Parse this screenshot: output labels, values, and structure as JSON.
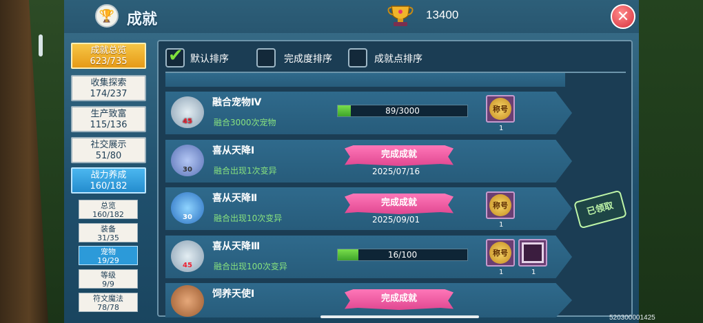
{
  "header": {
    "title": "成就",
    "score": "13400",
    "close_label": "✕"
  },
  "sidebar": {
    "items": [
      {
        "label": "成就总览",
        "count": "623/735"
      },
      {
        "label": "收集探索",
        "count": "174/237"
      },
      {
        "label": "生产致富",
        "count": "115/136"
      },
      {
        "label": "社交展示",
        "count": "51/80"
      },
      {
        "label": "战力养成",
        "count": "160/182"
      }
    ],
    "subitems": [
      {
        "label": "总览",
        "count": "160/182"
      },
      {
        "label": "装备",
        "count": "31/35"
      },
      {
        "label": "宠物",
        "count": "19/29"
      },
      {
        "label": "等级",
        "count": "9/9"
      },
      {
        "label": "符文魔法",
        "count": "78/78"
      }
    ]
  },
  "sort": {
    "default": "默认排序",
    "completion": "完成度排序",
    "points": "成就点排序"
  },
  "achievements": [
    {
      "name": "融合宠物Ⅳ",
      "desc": "融合3000次宠物",
      "level": "45",
      "progress_text": "89/3000",
      "progress": 0.03,
      "reward": "称号",
      "reward_qty": "1"
    },
    {
      "name": "喜从天降Ⅰ",
      "desc": "融合出现1次变异",
      "level": "30",
      "status": "完成成就",
      "date": "2025/07/16"
    },
    {
      "name": "喜从天降Ⅱ",
      "desc": "融合出现10次变异",
      "level": "30",
      "status": "完成成就",
      "date": "2025/09/01",
      "reward": "称号",
      "reward_qty": "1"
    },
    {
      "name": "喜从天降Ⅲ",
      "desc": "融合出现100次变异",
      "level": "45",
      "progress_text": "16/100",
      "progress": 0.16,
      "reward": "称号",
      "reward_qty": "1",
      "reward2_qty": "1"
    },
    {
      "name": "饲养天使Ⅰ",
      "status": "完成成就"
    }
  ],
  "claimed_stamp": "已领取",
  "uid": "520300001425",
  "colors": {
    "accent_gold": "#e69a17",
    "accent_blue": "#248ccd",
    "progress_green": "#3ea52a",
    "complete_pink": "#e04891"
  }
}
